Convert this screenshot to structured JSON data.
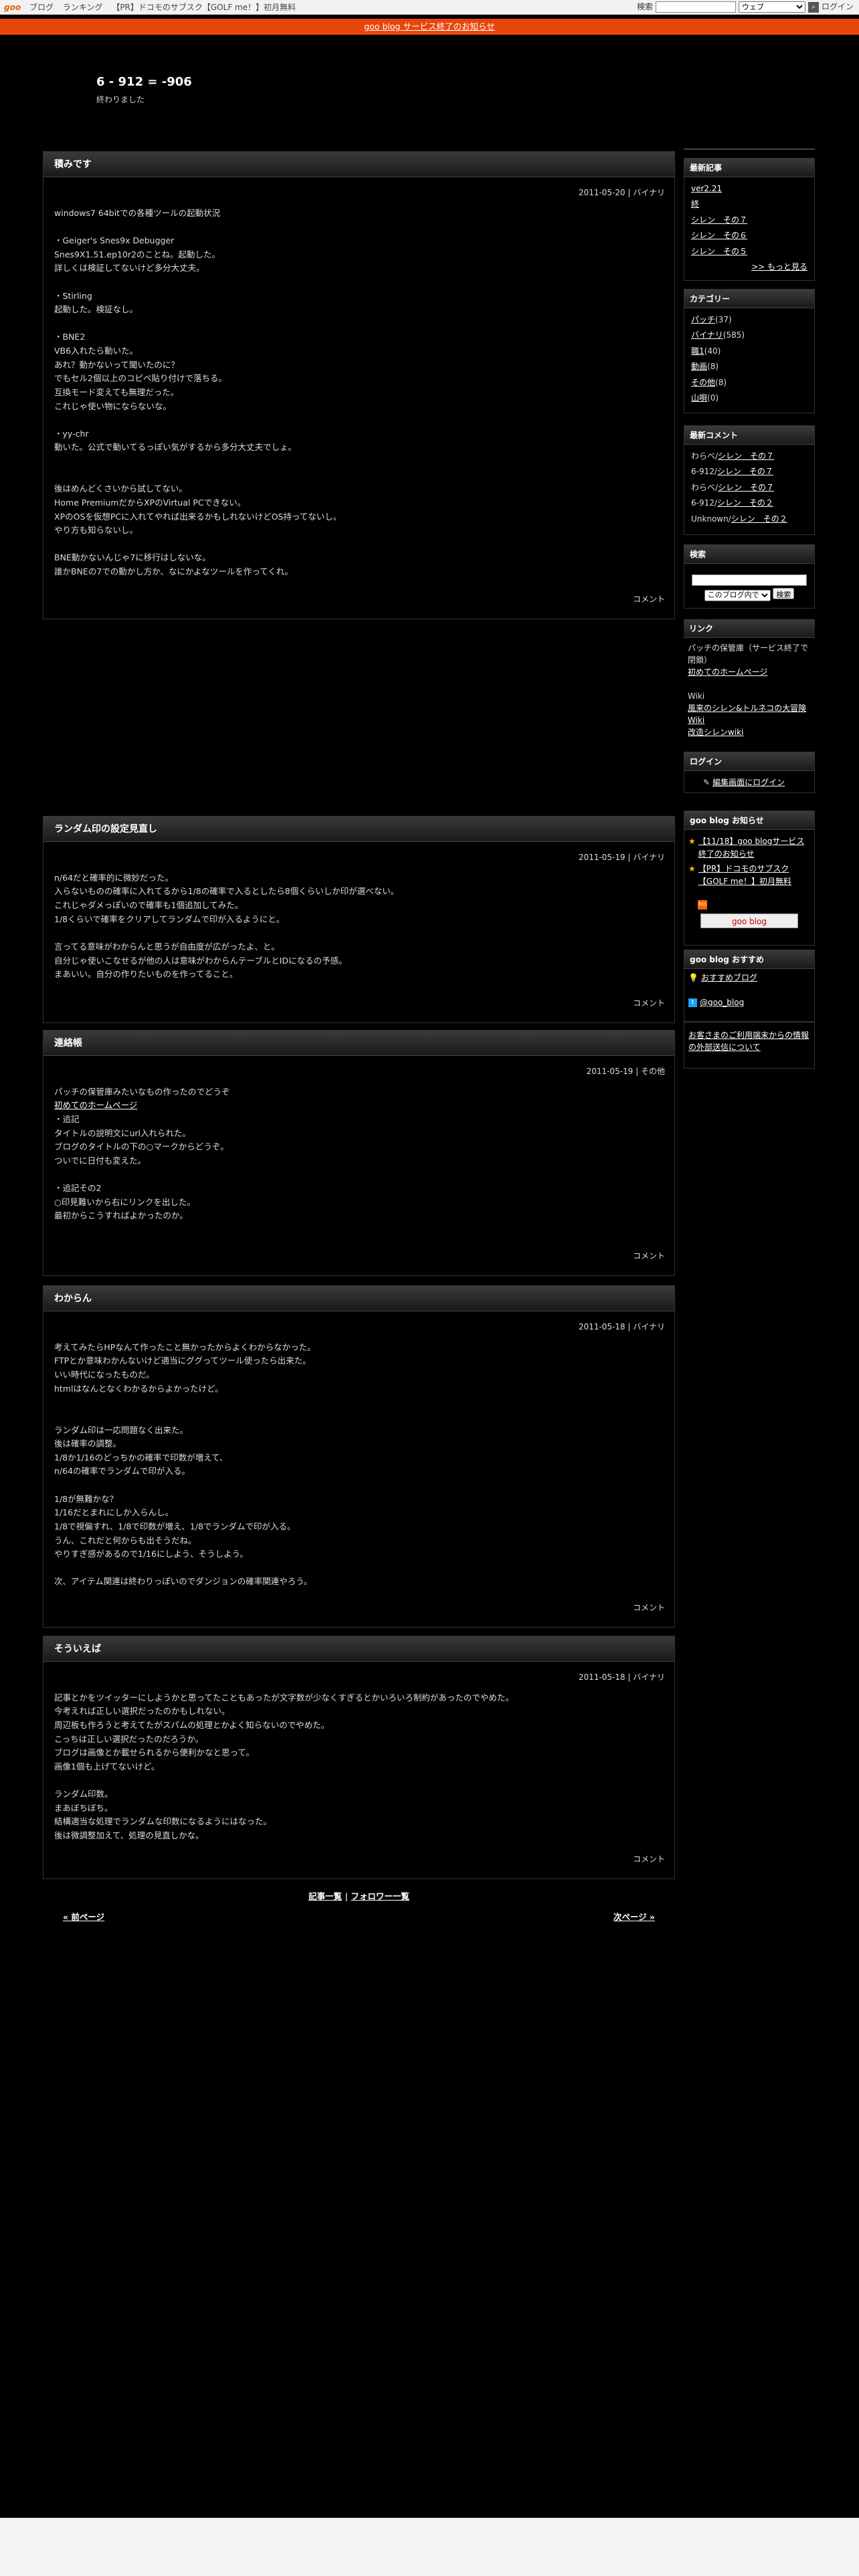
{
  "topbar": {
    "logo_a": "goo",
    "links": [
      "ブログ",
      "ランキング",
      "【PR】ドコモのサブスク【GOLF me！】初月無料"
    ],
    "search_label": "検索",
    "search_value": "",
    "search_option": "ウェブ",
    "login": "ログイン"
  },
  "notice": "goo blog サービス終了のお知らせ",
  "blog": {
    "title": "6 - 912 = -906",
    "description": "終わりました"
  },
  "entries": [
    {
      "title": "積みです",
      "date": "2011-05-20",
      "sep": " | ",
      "category": "バイナリ",
      "body": "windows7 64bitでの各種ツールの起動状況\n\n・Geiger's Snes9x Debugger\nSnes9X1.51.ep10r2のことね。起動した。\n詳しくは検証してないけど多分大丈夫。\n\n・Stirling\n起動した。検証なし。\n\n・BNE2\nVB6入れたら動いた。\nあれ？動かないって聞いたのに？\nでもセル2個以上のコピペ貼り付けで落ちる。\n互換モード変えても無理だった。\nこれじゃ使い物にならないな。\n\n・yy-chr\n動いた。公式で動いてるっぽい気がするから多分大丈夫でしょ。\n\n\n後はめんどくさいから試してない。\nHome PremiumだからXPのVirtual PCできない。\nXPのOSを仮想PCに入れてやれば出来るかもしれないけどOS持ってないし。\nやり方も知らないし。\n\nBNE動かないんじゃ7に移行はしないな。\n誰かBNEの7での動かし方か、なにかよなツールを作ってくれ。",
      "comment": "コメント"
    },
    {
      "title": "ランダム印の設定見直し",
      "date": "2011-05-19",
      "sep": " | ",
      "category": "バイナリ",
      "body": "n/64だと確率的に微妙だった。\n入らないものの確率に入れてるから1/8の確率で入るとしたら8個くらいしか印が選べない。\nこれじゃダメっぽいので確率も1個追加してみた。\n1/8くらいで確率をクリアしてランダムで印が入るようにと。\n\n言ってる意味がわからんと思うが自由度が広がったよ、と。\n自分じゃ使いこなせるが他の人は意味がわからんテーブルとIDになるの予感。\nまあいい。自分の作りたいものを作ってること。",
      "comment": "コメント"
    },
    {
      "title": "連絡帳",
      "date": "2011-05-19",
      "sep": " | ",
      "category": "その他",
      "body_intro": "パッチの保管庫みたいなもの作ったのでどうぞ",
      "link": "初めてのホームページ",
      "body": "\n・追記\nタイトルの説明文にurl入れられた。\nブログのタイトルの下の○マークからどうぞ。\nついでに日付も変えた。\n\n・追記その2\n○印見難いから右にリンクを出した。\n最初からこうすればよかったのか。",
      "comment": "コメント"
    },
    {
      "title": "わからん",
      "date": "2011-05-18",
      "sep": " | ",
      "category": "バイナリ",
      "body": "考えてみたらHPなんて作ったこと無かったからよくわからなかった。\nFTPとか意味わかんないけど適当にググってツール使ったら出来た。\nいい時代になったものだ。\nhtmlはなんとなくわかるからよかったけど。\n\n\nランダム印は一応問題なく出来た。\n後は確率の調整。\n1/8か1/16のどっちかの確率で印数が増えて、\nn/64の確率でランダムで印が入る。\n\n1/8が無難かな？\n1/16だとまれにしか入らんし。\n1/8で視偏すれ、1/8で印数が増え、1/8でランダムで印が入る。\nうん、これだと何からも出そうだね。\nやりすぎ感があるので1/16にしよう、そうしよう。\n\n次、アイテム関連は終わりっぽいのでダンジョンの確率関連やろう。",
      "comment": "コメント"
    },
    {
      "title": "そういえば",
      "date": "2011-05-18",
      "sep": " | ",
      "category": "バイナリ",
      "body": "記事とかをツイッターにしようかと思ってたこともあったが文字数が少なくすぎるとかいろいろ制約があったのでやめた。\n今考えれば正しい選択だったのかもしれない。\n周辺板も作ろうと考えてたがスパムの処理とかよく知らないのでやめた。\nこっちは正しい選択だったのだろうか。\nブログは画像とか載せられるから便利かなと思って。\n画像1個も上げてないけど。\n\nランダム印数。\nまあぼちぼち。\n結構適当な処理でランダムな印数になるようにはなった。\n後は微調整加えて、処理の見直しかな。",
      "comment": "コメント"
    }
  ],
  "pager": {
    "list": "記事一覧",
    "sep": " | ",
    "follow": "フォロワー一覧",
    "prev": "« 前ページ",
    "next": "次ページ »"
  },
  "sidebar": {
    "recent": {
      "title": "最新記事",
      "items": [
        "ver2.21",
        "終",
        "シレン　その７",
        "シレン　その６",
        "シレン　その５"
      ],
      "more": ">> もっと見る"
    },
    "category": {
      "title": "カテゴリー",
      "items": [
        {
          "name": "パッチ",
          "count": "(37)"
        },
        {
          "name": "バイナリ",
          "count": "(585)"
        },
        {
          "name": "職1",
          "count": "(40)"
        },
        {
          "name": "動画",
          "count": "(8)"
        },
        {
          "name": "その他",
          "count": "(8)"
        },
        {
          "name": "山唄",
          "count": "(0)"
        }
      ]
    },
    "comments": {
      "title": "最新コメント",
      "items": [
        {
          "who": "わらべ/",
          "entry": "シレン　その７"
        },
        {
          "who": "6-912/",
          "entry": "シレン　その７"
        },
        {
          "who": "わらべ/",
          "entry": "シレン　その７"
        },
        {
          "who": "6-912/",
          "entry": "シレン　その２"
        },
        {
          "who": "Unknown/",
          "entry": "シレン　その２"
        }
      ]
    },
    "search": {
      "title": "検索",
      "value": "",
      "scope": "このブログ内で",
      "button": "検索"
    },
    "links": {
      "title": "リンク",
      "desc": "パッチの保管庫（サービス終了で閉鎖）",
      "hp": "初めてのホームページ",
      "wiki_label": "Wiki",
      "wiki1": "風来のシレン&トルネコの大冒険 Wiki",
      "wiki2": "改造シレンwiki"
    },
    "login": {
      "title": "ログイン",
      "link": "編集画面にログイン"
    },
    "goonotice": {
      "title": "goo blog お知らせ",
      "items": [
        "【11/18】goo blogサービス終了のお知らせ",
        "【PR】ドコモのサブスク【GOLF me！】初月無料"
      ],
      "rss": "RSS",
      "button": "goo blog"
    },
    "recommend": {
      "title": "goo blog おすすめ",
      "link": "おすすめブログ",
      "twitter": "@goo_blog"
    },
    "privacy": "お客さまのご利用端末からの情報の外部送信について"
  },
  "colors": {
    "notice_bg": "#e8460c",
    "background": "#000000",
    "header_gradient_top": "#3a3a3a"
  }
}
